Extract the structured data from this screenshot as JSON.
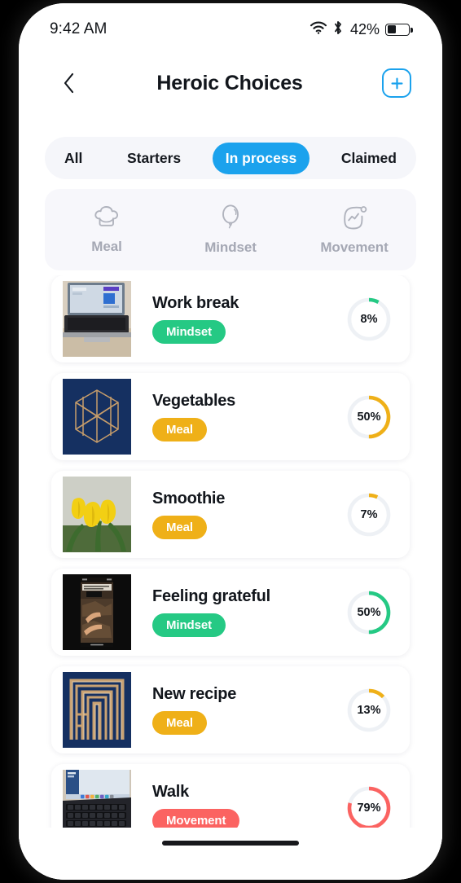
{
  "status_bar": {
    "time": "9:42 AM",
    "battery_percent": "42%",
    "wifi_icon": "wifi-icon",
    "bluetooth_icon": "bluetooth-icon",
    "battery_icon": "battery-icon",
    "battery_level": 42
  },
  "header": {
    "title": "Heroic Choices",
    "back_icon": "chevron-left-icon",
    "add_icon": "plus-icon",
    "accent_color": "#1ba2ed"
  },
  "status_tabs": {
    "items": [
      {
        "label": "All",
        "active": false
      },
      {
        "label": "Starters",
        "active": false
      },
      {
        "label": "In process",
        "active": true
      },
      {
        "label": "Claimed",
        "active": false
      }
    ],
    "active_color": "#1ba2ed"
  },
  "category_filter": {
    "items": [
      {
        "label": "Meal",
        "icon": "chef-hat-icon",
        "active": false
      },
      {
        "label": "Mindset",
        "icon": "balloon-icon",
        "active": false
      },
      {
        "label": "Movement",
        "icon": "activity-chart-icon",
        "active": false
      }
    ],
    "inactive_color": "#a5a8b4"
  },
  "colors": {
    "mindset": "#25c984",
    "meal": "#efb018",
    "movement": "#fb6361",
    "track": "#eef1f5"
  },
  "choices": [
    {
      "title": "Work break",
      "category": "Mindset",
      "category_key": "mindset",
      "progress_label": "8%",
      "progress": 8,
      "thumb": "laptop-on-desk-photo"
    },
    {
      "title": "Vegetables",
      "category": "Meal",
      "category_key": "meal",
      "progress_label": "50%",
      "progress": 50,
      "thumb": "gold-hexagon-graphic"
    },
    {
      "title": "Smoothie",
      "category": "Meal",
      "category_key": "meal",
      "progress_label": "7%",
      "progress": 7,
      "thumb": "yellow-tulips-photo"
    },
    {
      "title": "Feeling grateful",
      "category": "Mindset",
      "category_key": "mindset",
      "progress_label": "50%",
      "progress": 50,
      "thumb": "hands-on-ground-photo"
    },
    {
      "title": "New recipe",
      "category": "Meal",
      "category_key": "meal",
      "progress_label": "13%",
      "progress": 13,
      "thumb": "gold-spiral-graphic"
    },
    {
      "title": "Walk",
      "category": "Movement",
      "category_key": "movement",
      "progress_label": "79%",
      "progress": 79,
      "thumb": "laptop-keyboard-photo"
    }
  ]
}
